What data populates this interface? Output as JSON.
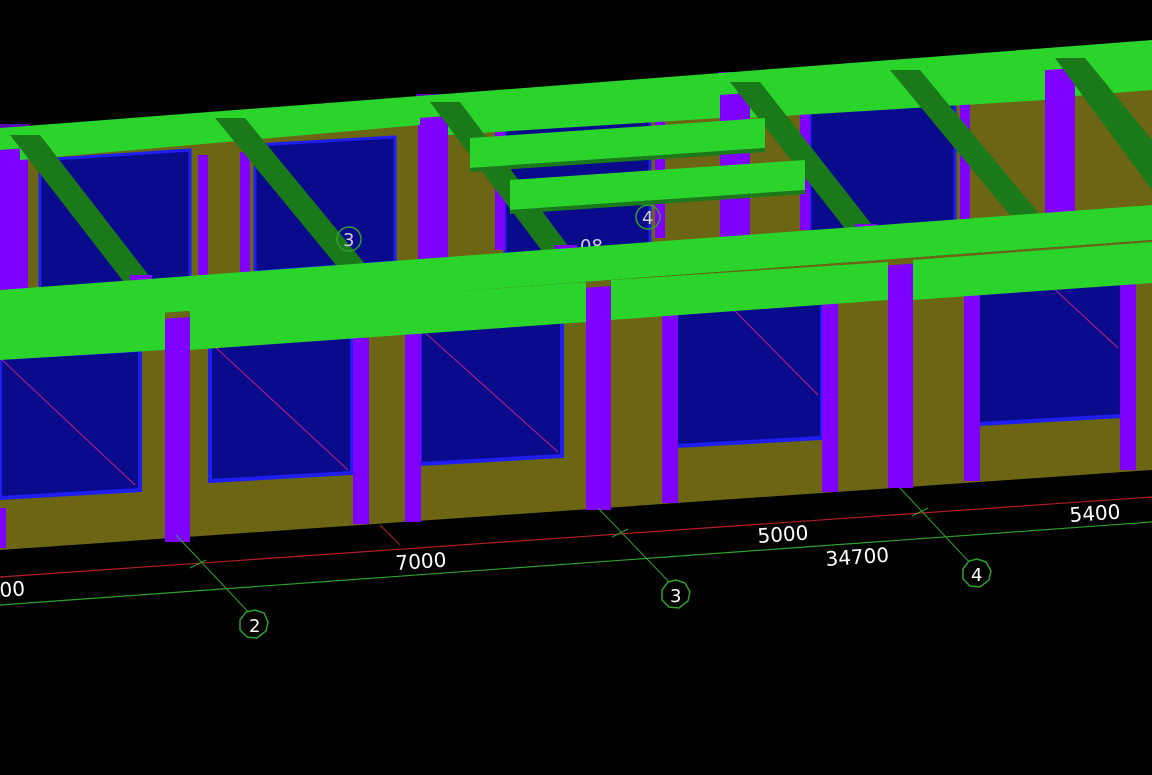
{
  "viewport": {
    "background": "#000000"
  },
  "colors": {
    "beam_top": "#2bd42b",
    "beam_side": "#1a7a1a",
    "column": "#8000ff",
    "column_dark": "#5a00b4",
    "wall": "#6b6514",
    "window_pane": "#0a0a8c",
    "window_frame": "#1e1ef0",
    "diagonal": "#c02080",
    "axis_line": "#2ea02e",
    "dim_line_red": "#b41e1e",
    "axis_bubble": "#2ea02e"
  },
  "dimensions": {
    "left_partial": "00",
    "span_1_2": "7000",
    "span_3_4": "5000",
    "span_4_5": "5400",
    "total": "34700"
  },
  "axes": {
    "front": [
      "2",
      "3",
      "4"
    ],
    "back": [
      "3",
      "4"
    ],
    "back_partial_label": "08"
  }
}
